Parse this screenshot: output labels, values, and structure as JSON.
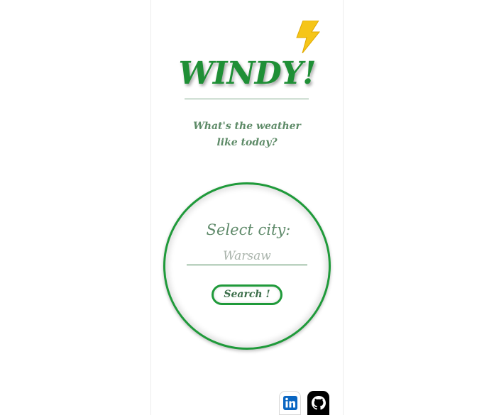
{
  "app": {
    "title": "WINDY!",
    "subtitle_line1": "What's the weather",
    "subtitle_line2": "like today?",
    "logo_icon": "lightning-bolt-icon",
    "accent_color": "#1f9a3a"
  },
  "search": {
    "label": "Select city:",
    "placeholder": "Warsaw",
    "value": "",
    "button_label": "Search !"
  },
  "footer": {
    "links": [
      {
        "icon": "linkedin-icon"
      },
      {
        "icon": "github-icon"
      }
    ]
  }
}
